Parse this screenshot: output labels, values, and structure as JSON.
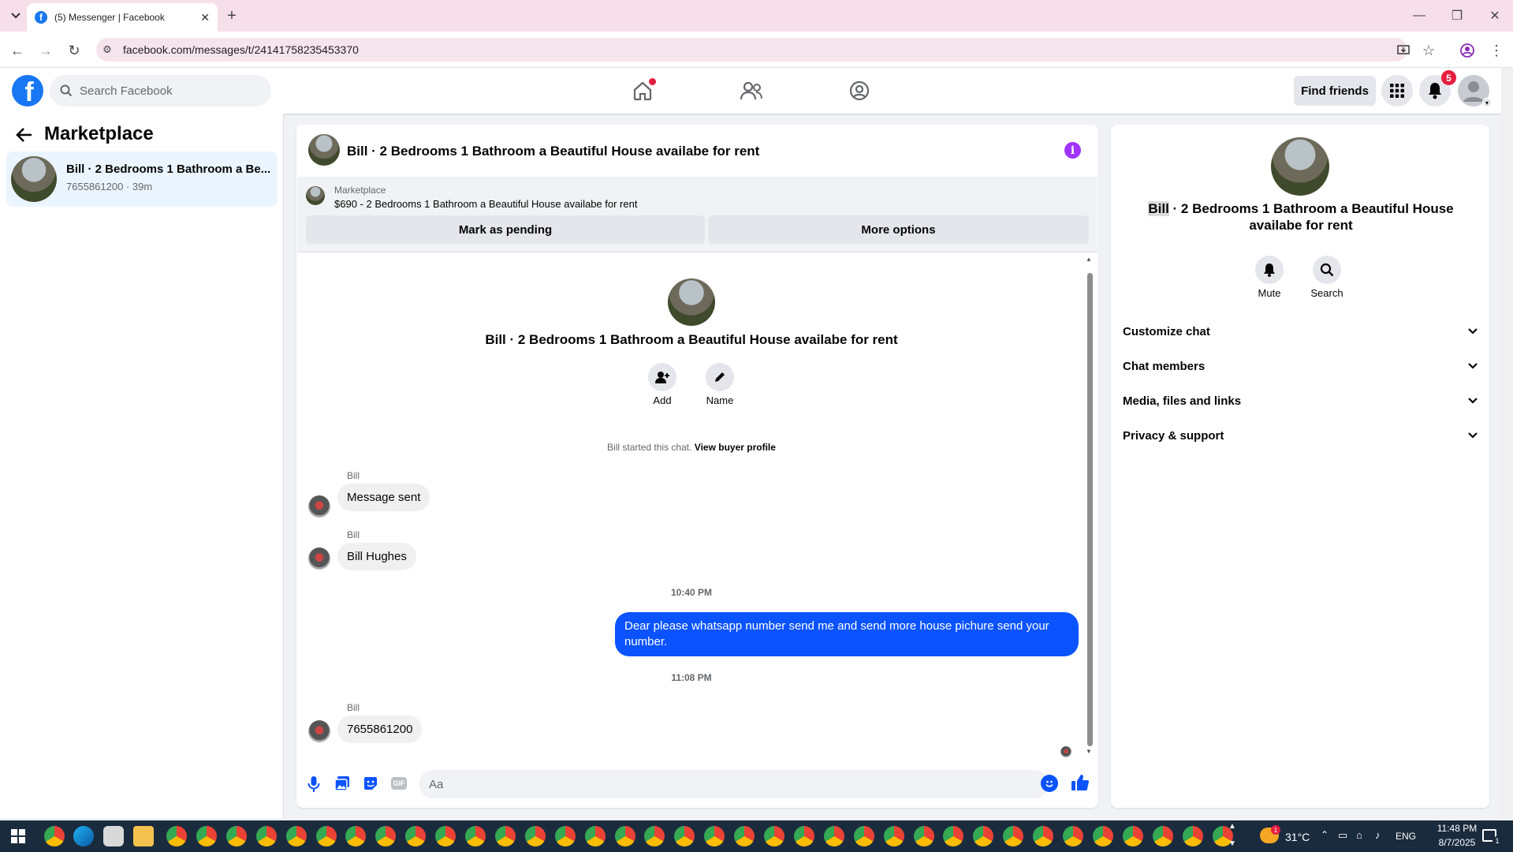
{
  "browser": {
    "tab_title": "(5) Messenger | Facebook",
    "url": "facebook.com/messages/t/24141758235453370"
  },
  "fb": {
    "search_placeholder": "Search Facebook",
    "find_friends": "Find friends",
    "notification_count": "5"
  },
  "left": {
    "title": "Marketplace",
    "conversation": {
      "name": "Bill · 2 Bedrooms 1 Bathroom a Be...",
      "meta": "7655861200 · 39m"
    }
  },
  "chat": {
    "header_title": "Bill · 2 Bedrooms 1 Bathroom a Beautiful House availabe for rent",
    "listing": {
      "source": "Marketplace",
      "summary": "$690 - 2 Bedrooms 1 Bathroom a Beautiful House availabe for rent",
      "mark_pending": "Mark as pending",
      "more_options": "More options"
    },
    "intro": {
      "title": "Bill · 2 Bedrooms 1 Bathroom a Beautiful House availabe for rent",
      "add_label": "Add",
      "name_label": "Name",
      "started_text": "Bill started this chat.",
      "view_profile": "View buyer profile"
    },
    "messages": [
      {
        "sender": "Bill",
        "text": "Message sent"
      },
      {
        "sender": "Bill",
        "text": "Bill Hughes"
      },
      {
        "timestamp": "10:40 PM"
      },
      {
        "outgoing": "Dear please whatsapp number send me and send more house pichure send your number."
      },
      {
        "timestamp": "11:08 PM"
      },
      {
        "sender": "Bill",
        "text": "7655861200"
      }
    ],
    "composer_placeholder": "Aa"
  },
  "right": {
    "title_highlight": "Bill",
    "title_rest": " · 2 Bedrooms 1 Bathroom a Beautiful House availabe for rent",
    "mute": "Mute",
    "search": "Search",
    "sections": [
      "Customize chat",
      "Chat members",
      "Media, files and links",
      "Privacy & support"
    ]
  },
  "taskbar": {
    "temperature": "31°C",
    "lang": "ENG",
    "time": "11:48 PM",
    "date": "8/7/2025",
    "notif": "1"
  },
  "colors": {
    "fb_blue": "#1877f2",
    "outgoing_bubble": "#0a53ff",
    "info_purple": "#a033ff"
  }
}
